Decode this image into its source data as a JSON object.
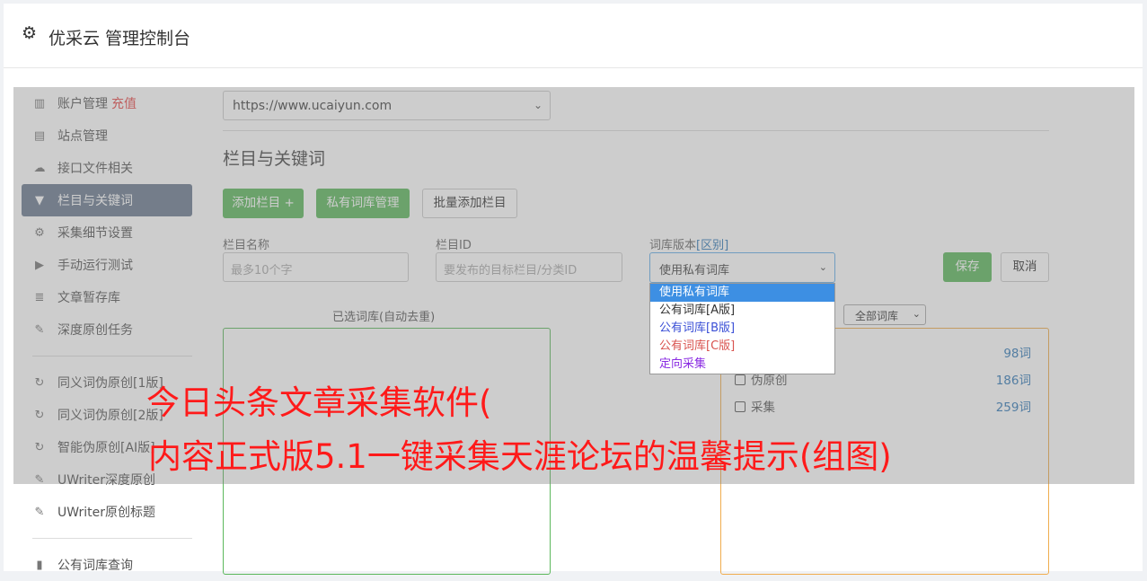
{
  "header": {
    "title": "优采云 管理控制台"
  },
  "sidebar": {
    "items": [
      {
        "icon": "bar-chart-icon",
        "label": "账户管理",
        "badge": "充值"
      },
      {
        "icon": "server-icon",
        "label": "站点管理"
      },
      {
        "icon": "cloud-upload-icon",
        "label": "接口文件相关"
      },
      {
        "icon": "filter-icon",
        "label": "栏目与关键词",
        "active": true
      },
      {
        "icon": "gears-icon",
        "label": "采集细节设置"
      },
      {
        "icon": "play-circle-icon",
        "label": "手动运行测试"
      },
      {
        "icon": "database-icon",
        "label": "文章暂存库"
      },
      {
        "icon": "edit-icon",
        "label": "深度原创任务"
      }
    ],
    "items2": [
      {
        "icon": "refresh-icon",
        "label": "同义词伪原创[1版]"
      },
      {
        "icon": "refresh-icon",
        "label": "同义词伪原创[2版]"
      },
      {
        "icon": "refresh-icon",
        "label": "智能伪原创[AI版]"
      },
      {
        "icon": "edit-icon",
        "label": "UWriter深度原创"
      },
      {
        "icon": "edit-icon",
        "label": "UWriter原创标题"
      }
    ],
    "items3": [
      {
        "icon": "book-icon",
        "label": "公有词库查询"
      }
    ]
  },
  "site_select": {
    "value": "https://www.ucaiyun.com"
  },
  "section_title": "栏目与关键词",
  "buttons": {
    "add_column": "添加栏目 +",
    "private_lib": "私有词库管理",
    "batch_add": "批量添加栏目",
    "save": "保存",
    "cancel": "取消"
  },
  "form": {
    "name_label": "栏目名称",
    "name_placeholder": "最多10个字",
    "id_label": "栏目ID",
    "id_placeholder": "要发布的目标栏目/分类ID",
    "lib_label": "词库版本",
    "lib_label_link": "[区别]",
    "lib_value": "使用私有词库"
  },
  "dropdown": {
    "options": [
      {
        "label": "使用私有词库",
        "color": "#ffffff"
      },
      {
        "label": "公有词库[A版]",
        "color": "#333333"
      },
      {
        "label": "公有词库[B版]",
        "color": "#3a4fd6"
      },
      {
        "label": "公有词库[C版]",
        "color": "#d9534f"
      },
      {
        "label": "定向采集",
        "color": "#8a2be2"
      }
    ]
  },
  "selected_box_title": "已选词库(自动去重)",
  "filter": {
    "value": "全部词库"
  },
  "libraries": [
    {
      "label": "",
      "count": "98词"
    },
    {
      "label": "伪原创",
      "count": "186词"
    },
    {
      "label": "采集",
      "count": "259词"
    }
  ],
  "caption": {
    "line1": "今日头条文章采集软件(",
    "line2": "内容正式版5.1一键采集天涯论坛的温馨提示(组图)"
  }
}
